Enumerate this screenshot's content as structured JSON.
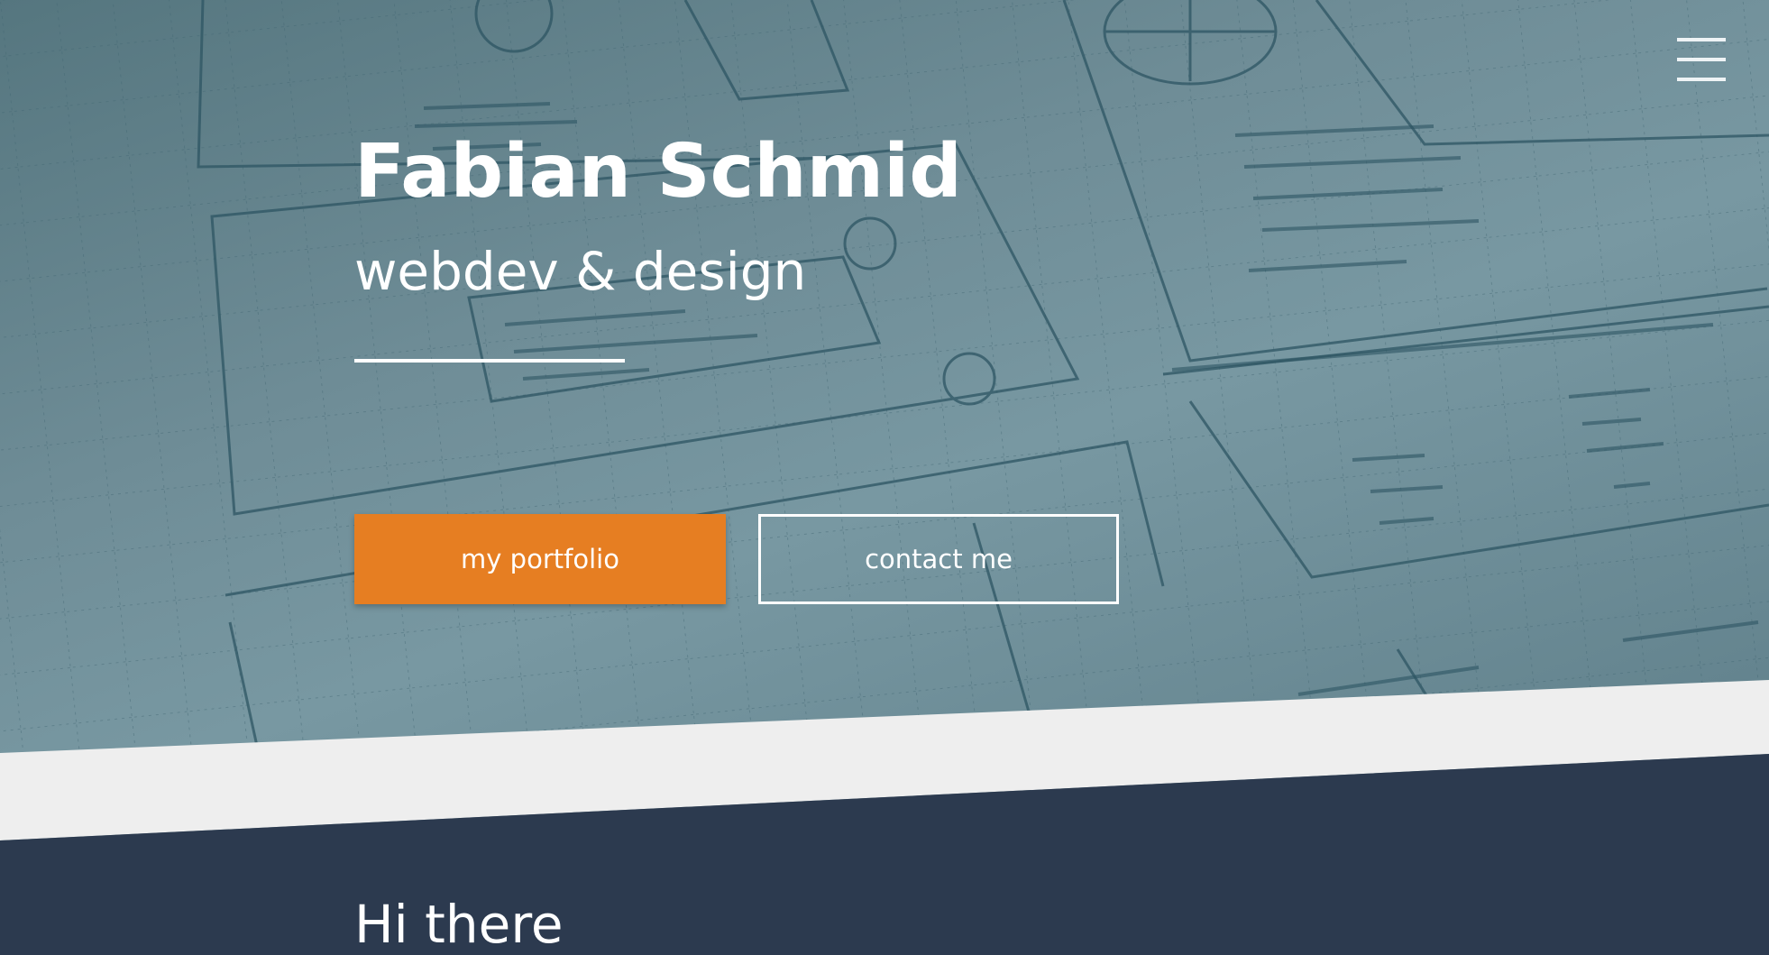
{
  "hero": {
    "title": "Fabian Schmid",
    "subtitle": "webdev & design",
    "background_image": "hand-drawn wireframe sketch on grid paper"
  },
  "nav": {
    "menu_icon": "hamburger-menu-icon"
  },
  "buttons": {
    "portfolio_label": "my portfolio",
    "contact_label": "contact me"
  },
  "about": {
    "heading": "Hi there"
  },
  "colors": {
    "accent": "#e67e22",
    "dark_section": "#2c3a4f",
    "divider_band": "#eeeeee",
    "hero_tint": "#6f8d97"
  }
}
